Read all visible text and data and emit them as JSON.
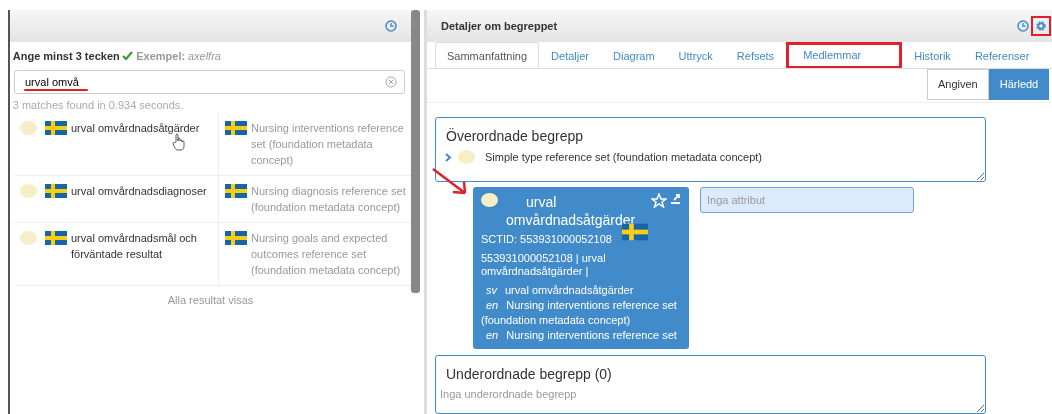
{
  "search_panel": {
    "prompt": "Ange minst 3 tecken",
    "example_label": "Exempel:",
    "example_value": "axelfra",
    "search": {
      "value": "urval omvå",
      "underlined": true
    },
    "status": "3 matches found in 0.934 seconds.",
    "results": [
      {
        "term": "urval omvårdnadsåtgärder",
        "description": "Nursing interventions reference set (foundation metadata concept)",
        "hovered": true
      },
      {
        "term": "urval omvårdnadsdiagnoser",
        "description": "Nursing diagnosis reference set (foundation metadata concept)",
        "hovered": false
      },
      {
        "term": "urval omvårdnadsmål och förväntade resultat",
        "description": "Nursing goals and expected outcomes reference set (foundation metadata concept)",
        "hovered": false
      }
    ],
    "footer": "Alla resultat visas"
  },
  "details_panel": {
    "title": "Detaljer om begreppet",
    "settings_highlighted": true,
    "tabs": [
      {
        "label": "Sammanfattning",
        "selected": true,
        "highlighted": false
      },
      {
        "label": "Detaljer",
        "selected": false,
        "highlighted": false
      },
      {
        "label": "Diagram",
        "selected": false,
        "highlighted": false
      },
      {
        "label": "Uttryck",
        "selected": false,
        "highlighted": false
      },
      {
        "label": "Refsets",
        "selected": false,
        "highlighted": false
      },
      {
        "label": "Medlemmar",
        "selected": false,
        "highlighted": true
      },
      {
        "label": "Historik",
        "selected": false,
        "highlighted": false
      },
      {
        "label": "Referenser",
        "selected": false,
        "highlighted": false
      }
    ],
    "view_toggle": [
      {
        "label": "Angiven",
        "selected": false
      },
      {
        "label": "Härledd",
        "selected": true
      }
    ],
    "parents": {
      "title": "Överordnade begrepp",
      "items": [
        {
          "label": "Simple type reference set (foundation metadata concept)"
        }
      ]
    },
    "concept": {
      "name": "urval omvårdnadsåtgärder",
      "sctid": "SCTID: 553931000052108",
      "fsn": "553931000052108 | urval omvårdnadsåtgärder |",
      "descriptions": [
        {
          "lang": "sv",
          "text": "urval omvårdnadsåtgärder"
        },
        {
          "lang": "en",
          "text": "Nursing interventions reference set (foundation metadata concept)"
        },
        {
          "lang": "en",
          "text": "Nursing interventions reference set"
        }
      ]
    },
    "attributes": {
      "placeholder": "Inga attribut"
    },
    "children": {
      "title": "Underordnade begrepp (0)",
      "empty": "Inga underordnade begrepp"
    }
  }
}
